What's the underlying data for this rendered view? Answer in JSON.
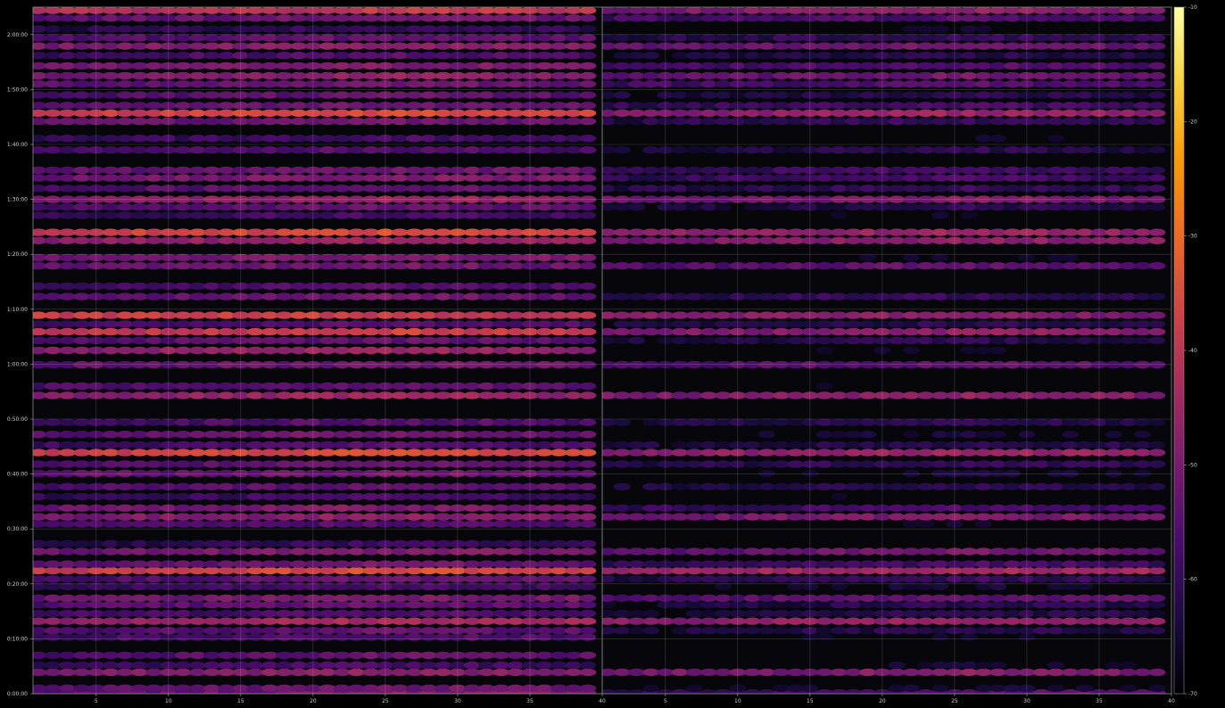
{
  "chart_data": {
    "type": "heatmap",
    "title": "",
    "xlabel": "",
    "ylabel": "",
    "panels": [
      {
        "name": "",
        "x_range": [
          1,
          40
        ],
        "x_ticks": [
          "5",
          "10",
          "15",
          "20",
          "25",
          "30",
          "35",
          "40"
        ]
      },
      {
        "name": "",
        "x_range": [
          1,
          40
        ],
        "x_ticks": [
          "5",
          "10",
          "15",
          "20",
          "25",
          "30",
          "35",
          "40"
        ]
      }
    ],
    "y_range": [
      "0:00:00",
      "2:05:00"
    ],
    "y_ticks": [
      "0:00:00",
      "0:10:00",
      "0:20:00",
      "0:30:00",
      "0:40:00",
      "0:50:00",
      "1:00:00",
      "1:10:00",
      "1:20:00",
      "1:30:00",
      "1:40:00",
      "1:50:00",
      "2:00:00"
    ],
    "colorbar": {
      "range": [
        -70,
        -10
      ],
      "ticks": [
        "-70",
        "-60",
        "-50",
        "-40",
        "-30",
        "-20",
        "-10"
      ],
      "colormap": "inferno",
      "colors": [
        "#000004",
        "#1b0c41",
        "#4a0c6b",
        "#781c6d",
        "#a52c60",
        "#cf4446",
        "#ed6925",
        "#fb9b06",
        "#f7d13d",
        "#fcffa4"
      ]
    },
    "grid": true,
    "bands": [
      {
        "t": 0.15,
        "p1": -46,
        "p2": -52,
        "ramp": 1
      },
      {
        "t": 1.0,
        "p1": -50,
        "p2": -64,
        "ramp": 0
      },
      {
        "t": 3.9,
        "p1": -46,
        "p2": -47,
        "ramp": 0
      },
      {
        "t": 5.2,
        "p1": -56,
        "p2": -65,
        "ramp": 0
      },
      {
        "t": 7.0,
        "p1": -52,
        "p2": -70,
        "ramp": 0
      },
      {
        "t": 10.3,
        "p1": -54,
        "p2": -66,
        "ramp": 0
      },
      {
        "t": 11.5,
        "p1": -52,
        "p2": -60,
        "ramp": 0
      },
      {
        "t": 13.2,
        "p1": -42,
        "p2": -44,
        "ramp": 0
      },
      {
        "t": 14.6,
        "p1": -54,
        "p2": -60,
        "ramp": 0
      },
      {
        "t": 16.2,
        "p1": -52,
        "p2": -60,
        "ramp": 0
      },
      {
        "t": 17.4,
        "p1": -48,
        "p2": -52,
        "ramp": 0
      },
      {
        "t": 19.5,
        "p1": -56,
        "p2": -64,
        "ramp": 0
      },
      {
        "t": 20.9,
        "p1": -52,
        "p2": -58,
        "ramp": 0
      },
      {
        "t": 22.4,
        "p1": -34,
        "p2": -42,
        "ramp": 0
      },
      {
        "t": 23.6,
        "p1": -50,
        "p2": -56,
        "ramp": 0
      },
      {
        "t": 25.9,
        "p1": -48,
        "p2": -50,
        "ramp": 0
      },
      {
        "t": 27.3,
        "p1": -58,
        "p2": -70,
        "ramp": 0
      },
      {
        "t": 30.9,
        "p1": -54,
        "p2": -66,
        "ramp": 0
      },
      {
        "t": 32.2,
        "p1": -46,
        "p2": -48,
        "ramp": 0
      },
      {
        "t": 33.8,
        "p1": -48,
        "p2": -56,
        "ramp": 0
      },
      {
        "t": 35.9,
        "p1": -56,
        "p2": -66,
        "ramp": 0
      },
      {
        "t": 37.7,
        "p1": -52,
        "p2": -60,
        "ramp": 0
      },
      {
        "t": 40.1,
        "p1": -50,
        "p2": -64,
        "ramp": 0
      },
      {
        "t": 41.8,
        "p1": -52,
        "p2": -58,
        "ramp": 0
      },
      {
        "t": 43.9,
        "p1": -34,
        "p2": -44,
        "ramp": 0
      },
      {
        "t": 45.3,
        "p1": -54,
        "p2": -60,
        "ramp": 0
      },
      {
        "t": 47.2,
        "p1": -50,
        "p2": -64,
        "ramp": 0
      },
      {
        "t": 49.4,
        "p1": -54,
        "p2": -60,
        "ramp": 0
      },
      {
        "t": 54.3,
        "p1": -44,
        "p2": -46,
        "ramp": 0
      },
      {
        "t": 56.0,
        "p1": -52,
        "p2": -66,
        "ramp": 0
      },
      {
        "t": 59.9,
        "p1": -50,
        "p2": -52,
        "ramp": 0
      },
      {
        "t": 62.5,
        "p1": -44,
        "p2": -66,
        "ramp": 0
      },
      {
        "t": 64.3,
        "p1": -52,
        "p2": -60,
        "ramp": 0
      },
      {
        "t": 65.9,
        "p1": -36,
        "p2": -46,
        "ramp": 0
      },
      {
        "t": 67.3,
        "p1": -54,
        "p2": -60,
        "ramp": 0
      },
      {
        "t": 68.9,
        "p1": -38,
        "p2": -48,
        "ramp": -1
      },
      {
        "t": 72.3,
        "p1": -50,
        "p2": -58,
        "ramp": 0
      },
      {
        "t": 74.2,
        "p1": -54,
        "p2": -70,
        "ramp": 0
      },
      {
        "t": 77.9,
        "p1": -50,
        "p2": -52,
        "ramp": 0
      },
      {
        "t": 79.4,
        "p1": -48,
        "p2": -66,
        "ramp": 0
      },
      {
        "t": 82.5,
        "p1": -44,
        "p2": -46,
        "ramp": 0
      },
      {
        "t": 84.0,
        "p1": -34,
        "p2": -44,
        "ramp": 0
      },
      {
        "t": 87.1,
        "p1": -56,
        "p2": -66,
        "ramp": 0
      },
      {
        "t": 88.6,
        "p1": -52,
        "p2": -60,
        "ramp": 0
      },
      {
        "t": 90.0,
        "p1": -44,
        "p2": -48,
        "ramp": 0
      },
      {
        "t": 92.0,
        "p1": -52,
        "p2": -58,
        "ramp": 0
      },
      {
        "t": 93.9,
        "p1": -48,
        "p2": -56,
        "ramp": 0
      },
      {
        "t": 95.3,
        "p1": -50,
        "p2": -56,
        "ramp": 0
      },
      {
        "t": 99.0,
        "p1": -54,
        "p2": -60,
        "ramp": 0
      },
      {
        "t": 101.1,
        "p1": -56,
        "p2": -66,
        "ramp": 0
      },
      {
        "t": 104.2,
        "p1": -50,
        "p2": -58,
        "ramp": 0
      },
      {
        "t": 105.7,
        "p1": -34,
        "p2": -44,
        "ramp": 0
      },
      {
        "t": 107.1,
        "p1": -50,
        "p2": -56,
        "ramp": 0
      },
      {
        "t": 109.0,
        "p1": -52,
        "p2": -60,
        "ramp": 0
      },
      {
        "t": 111.0,
        "p1": -50,
        "p2": -54,
        "ramp": 0
      },
      {
        "t": 112.5,
        "p1": -46,
        "p2": -50,
        "ramp": 0
      },
      {
        "t": 114.3,
        "p1": -48,
        "p2": -54,
        "ramp": 0
      },
      {
        "t": 116.2,
        "p1": -54,
        "p2": -60,
        "ramp": 0
      },
      {
        "t": 117.9,
        "p1": -46,
        "p2": -50,
        "ramp": 0
      },
      {
        "t": 119.4,
        "p1": -52,
        "p2": -58,
        "ramp": 0
      },
      {
        "t": 121.0,
        "p1": -58,
        "p2": -66,
        "ramp": 0
      },
      {
        "t": 123.0,
        "p1": -50,
        "p2": -54,
        "ramp": 0
      },
      {
        "t": 124.4,
        "p1": -38,
        "p2": -46,
        "ramp": 0
      }
    ]
  }
}
